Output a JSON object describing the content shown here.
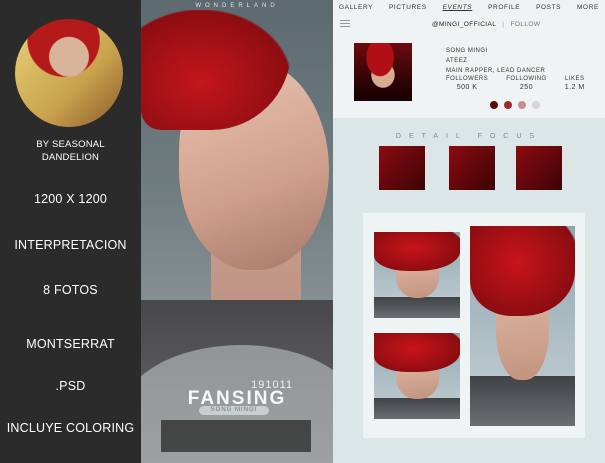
{
  "left_panel": {
    "credit_line1": "BY SEASONAL",
    "credit_line2": "DANDELION",
    "size": "1200 X 1200",
    "type": "INTERPRETACION",
    "photos": "8 FOTOS",
    "font": "MONTSERRAT",
    "format": ".PSD",
    "extra": "INCLUYE COLORING"
  },
  "poster": {
    "brand": "WONDERLAND",
    "date": "191011",
    "title": "FANSING",
    "subtitle": "SONG MINGI"
  },
  "nav": {
    "items": [
      "GALLERY",
      "PICTURES",
      "EVENTS",
      "PROFILE",
      "POSTS",
      "MORE"
    ],
    "active": "EVENTS"
  },
  "profile": {
    "handle": "@MINGI_OFFICIAL",
    "separator": "|",
    "follow": "FOLLOW",
    "name": "SONG MINGI",
    "group": "ATEEZ",
    "role": "MAIN RAPPER, LEAD DANCER",
    "stats": [
      {
        "label": "FOLLOWERS",
        "value": "500 K"
      },
      {
        "label": "FOLLOWING",
        "value": "250"
      },
      {
        "label": "LIKES",
        "value": "1.2 M"
      }
    ],
    "palette": [
      "#5a0a0c",
      "#9b2b2e",
      "#c98d8f",
      "#d6d6d6"
    ]
  },
  "detail": {
    "heading": "DETAIL FOCUS"
  },
  "colors": {
    "accent_red": "#b51a1a",
    "panel_dark": "#2b2b2b",
    "ui_bg": "#dde6e6"
  }
}
